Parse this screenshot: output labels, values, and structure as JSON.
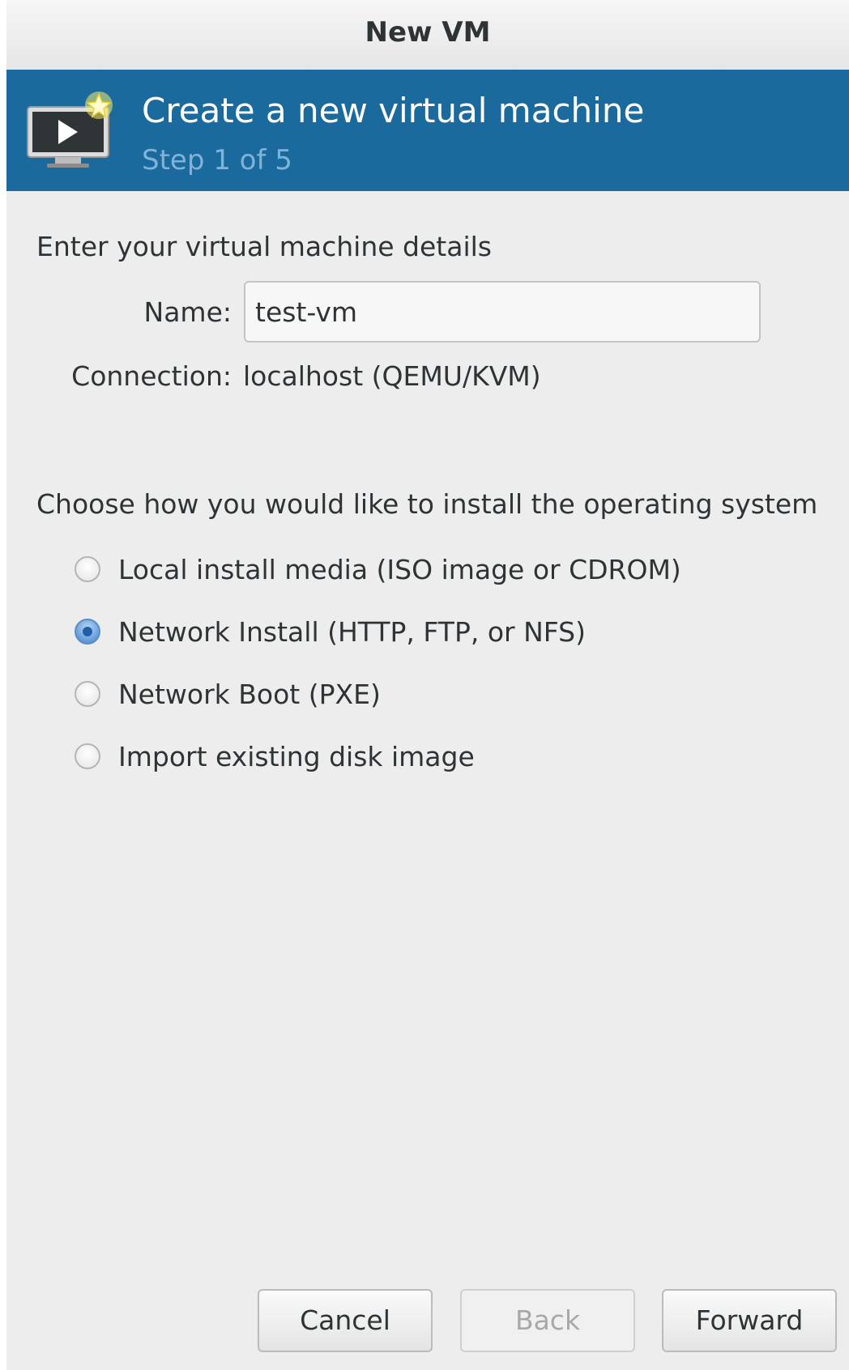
{
  "window": {
    "title": "New VM"
  },
  "banner": {
    "title": "Create a new virtual machine",
    "step": "Step 1 of 5",
    "icon": "monitor-new-icon"
  },
  "details": {
    "heading": "Enter your virtual machine details",
    "name_label": "Name:",
    "name_value": "test-vm",
    "connection_label": "Connection:",
    "connection_value": "localhost (QEMU/KVM)"
  },
  "install": {
    "heading": "Choose how you would like to install the operating system",
    "options": [
      {
        "label": "Local install media (ISO image or CDROM)",
        "checked": false
      },
      {
        "label": "Network Install (HTTP, FTP, or NFS)",
        "checked": true
      },
      {
        "label": "Network Boot (PXE)",
        "checked": false
      },
      {
        "label": "Import existing disk image",
        "checked": false
      }
    ]
  },
  "buttons": {
    "cancel": "Cancel",
    "back": "Back",
    "forward": "Forward",
    "back_enabled": false
  },
  "colors": {
    "banner_bg": "#1b6a9e",
    "step_text": "#7fb3d8",
    "window_bg": "#ededed"
  }
}
